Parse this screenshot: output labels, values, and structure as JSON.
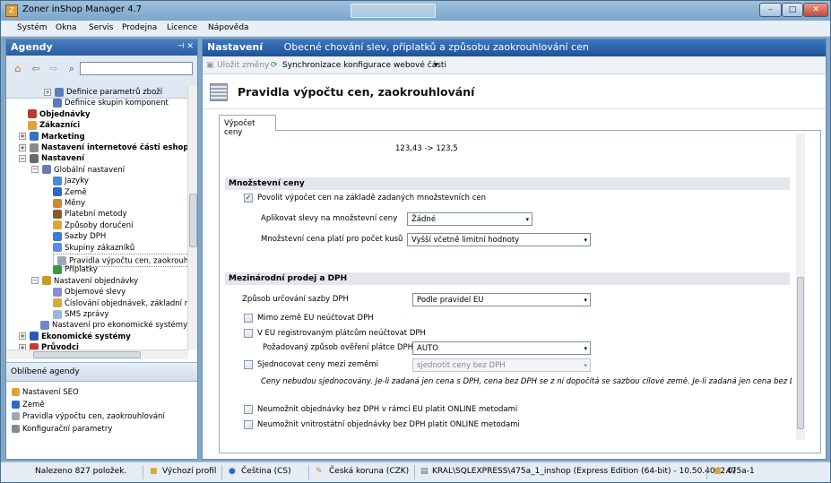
{
  "window": {
    "title": "Zoner inShop Manager 4.7",
    "buttons": [
      "–",
      "□",
      "✕"
    ]
  },
  "menu": [
    "Systém",
    "Okna",
    "Servis",
    "Prodejna",
    "Licence",
    "Nápověda"
  ],
  "left_panel": {
    "title": "Agendy",
    "pin_label": "⊣ ✕",
    "search_placeholder": "",
    "tree": [
      {
        "label": "Definice parametrů zboží",
        "level": 2,
        "expander": "+",
        "icon": "grid-icon",
        "color": "#5a7cb8"
      },
      {
        "label": "Definice skupin komponent",
        "level": 2,
        "expander": "",
        "icon": "grid-icon",
        "color": "#5a7cb8"
      },
      {
        "label": "Objednávky",
        "level": 0,
        "expander": "",
        "bold": true,
        "icon": "orders-icon",
        "color": "#c23a2a"
      },
      {
        "label": "Zákazníci",
        "level": 0,
        "expander": "",
        "bold": true,
        "icon": "customers-icon",
        "color": "#e3a235"
      },
      {
        "label": "Marketing",
        "level": 0,
        "expander": "+",
        "bold": true,
        "icon": "marketing-icon",
        "color": "#3a6fc2"
      },
      {
        "label": "Nastavení internetové části eshop",
        "level": 0,
        "expander": "+",
        "bold": true,
        "icon": "gear-icon",
        "color": "#8a8a8a"
      },
      {
        "label": "Nastavení",
        "level": 0,
        "expander": "−",
        "bold": true,
        "icon": "tools-icon",
        "color": "#6a6a6a"
      },
      {
        "label": "Globální nastavení",
        "level": 1,
        "expander": "−",
        "icon": "settings-icon",
        "color": "#6a7ab8"
      },
      {
        "label": "Jazyky",
        "level": 2,
        "expander": "",
        "icon": "languages-icon",
        "color": "#4a8ad8"
      },
      {
        "label": "Země",
        "level": 2,
        "expander": "",
        "icon": "globe-icon",
        "color": "#2a6ac8"
      },
      {
        "label": "Měny",
        "level": 2,
        "expander": "",
        "icon": "currency-icon",
        "color": "#c88a2a"
      },
      {
        "label": "Platební metody",
        "level": 2,
        "expander": "",
        "icon": "payment-icon",
        "color": "#8a5a2a"
      },
      {
        "label": "Způsoby doručení",
        "level": 2,
        "expander": "",
        "icon": "delivery-icon",
        "color": "#d8a83a"
      },
      {
        "label": "Sazby DPH",
        "level": 2,
        "expander": "",
        "icon": "vat-icon",
        "color": "#3a7ad8"
      },
      {
        "label": "Skupiny zákazníků",
        "level": 2,
        "expander": "",
        "icon": "customer-groups-icon",
        "color": "#5a8ae8"
      },
      {
        "label": "Pravidla výpočtu cen, zaokrouhlování",
        "level": 2,
        "expander": "",
        "icon": "price-rules-icon",
        "color": "#9aa8b8",
        "selected": true
      },
      {
        "label": "Příplatky",
        "level": 2,
        "expander": "",
        "icon": "surcharge-icon",
        "color": "#3a9a3a"
      },
      {
        "label": "Nastavení objednávky",
        "level": 1,
        "expander": "−",
        "icon": "order-settings-icon",
        "color": "#c89a2a"
      },
      {
        "label": "Objemové slevy",
        "level": 2,
        "expander": "",
        "icon": "discount-icon",
        "color": "#8a8ad8"
      },
      {
        "label": "Číslování objednávek, základní n",
        "level": 2,
        "expander": "",
        "icon": "numbering-icon",
        "color": "#d8a83a"
      },
      {
        "label": "SMS zprávy",
        "level": 2,
        "expander": "",
        "icon": "sms-icon",
        "color": "#9ab8d8"
      },
      {
        "label": "Nastavení pro ekonomické systémy",
        "level": 1,
        "expander": "",
        "icon": "economy-settings-icon",
        "color": "#6a8ac8"
      },
      {
        "label": "Ekonomické systémy",
        "level": 0,
        "expander": "+",
        "bold": true,
        "icon": "economy-icon",
        "color": "#2a5ab8"
      },
      {
        "label": "Průvodci",
        "level": 0,
        "expander": "+",
        "bold": true,
        "icon": "wizard-icon",
        "color": "#c83a2a"
      }
    ],
    "favorites_title": "Oblíbené agendy",
    "favorites": [
      {
        "label": "Nastavení SEO",
        "icon": "seo-icon",
        "color": "#e3a235"
      },
      {
        "label": "Země",
        "icon": "globe-icon",
        "color": "#2a6ac8"
      },
      {
        "label": "Pravidla výpočtu cen, zaokrouhlování",
        "icon": "price-rules-icon",
        "color": "#9aa8b8"
      },
      {
        "label": "Konfigurační parametry",
        "icon": "gear-icon",
        "color": "#8a8a8a"
      }
    ]
  },
  "right_panel": {
    "header_title": "Nastavení",
    "header_subtitle": "Obecné chování slev, příplatků a způsobu zaokrouhlování cen",
    "toolbar": {
      "save": "Uložit změny",
      "sync": "Synchronizace konfigurace webové části",
      "sync_arrow": "▾"
    },
    "page_title": "Pravidla výpočtu cen, zaokrouhlování",
    "tab": "Výpočet ceny",
    "example": "123,43 -> 123,5",
    "quantity_section": {
      "title": "Množstevní ceny",
      "allow_label": "Povolit výpočet cen na základě zadaných množstevních cen",
      "allow_checked": true,
      "apply_label": "Aplikovat slevy na množstevní ceny",
      "apply_value": "Žádné",
      "price_label": "Množstevní cena platí pro počet kusů",
      "price_value": "Vyšší včetně limitní hodnoty"
    },
    "intl_section": {
      "title": "Mezinárodní prodej a DPH",
      "vat_mode_label": "Způsob určování sazby DPH",
      "vat_mode_value": "Podle pravidel EU",
      "no_vat_outside_eu": "Mimo země EU neúčtovat DPH",
      "no_vat_registered": "V EU registrovaným plátcům neúčtovat DPH",
      "verify_label": "Požadovaný způsob ověření plátce DPH",
      "verify_value": "AUTO",
      "unify_label": "Sjednocovat ceny mezi zeměmi",
      "unify_value": "sjednotit ceny bez DPH",
      "note": "Ceny nebudou sjednocovány. Je-li zadaná jen cena s DPH, cena bez DPH se z ní dopočítá se sazbou cílové země. Je-li zadaná jen cena bez DPH, cena s DPH se z",
      "block_eu": "Neumožnit objednávky bez DPH v rámci EU platit ONLINE metodami",
      "block_domestic": "Neumožnit vnitrostátní objednávky bez DPH platit ONLINE metodami",
      "arrow": "▾"
    }
  },
  "status": {
    "found": "Nalezeno 827 položek.",
    "profile": "Výchozí profil",
    "language": "Čeština (CS)",
    "currency": "Česká koruna (CZK)",
    "server": "KRAL\\SQLEXPRESS\\475a_1_inshop (Express Edition (64-bit) - 10.50.4042.0)",
    "db": "475a-1"
  }
}
